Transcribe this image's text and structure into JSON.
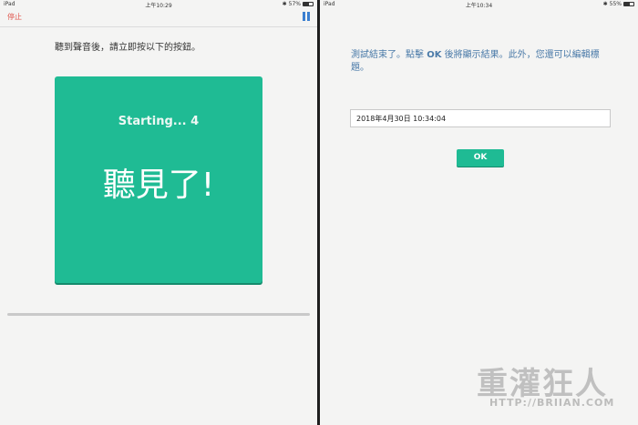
{
  "left_screen": {
    "status": {
      "carrier": "iPad",
      "time": "上午10:29",
      "battery": "57%",
      "battery_level": 0.57
    },
    "nav": {
      "stop_label": "停止"
    },
    "instruction": "聽到聲音後，請立即按以下的按鈕。",
    "button": {
      "starting_text": "Starting... 4",
      "heard_text": "聽見了!"
    },
    "progress": 0.0
  },
  "right_screen": {
    "status": {
      "carrier": "iPad",
      "time": "上午10:34",
      "battery": "55%",
      "battery_level": 0.55
    },
    "message_before": "測試結束了。點擊 ",
    "message_ok": "OK",
    "message_after": " 後將顯示結果。此外，您還可以編輯標題。",
    "title_value": "2018年4月30日 10:34:04",
    "ok_label": "OK"
  },
  "watermark": {
    "logo": "重灌狂人",
    "url": "HTTP://BRIIAN.COM"
  },
  "colors": {
    "accent": "#1fbb94",
    "stop": "#e0584f",
    "pause": "#3a7fd0",
    "message": "#4a7aa8"
  }
}
